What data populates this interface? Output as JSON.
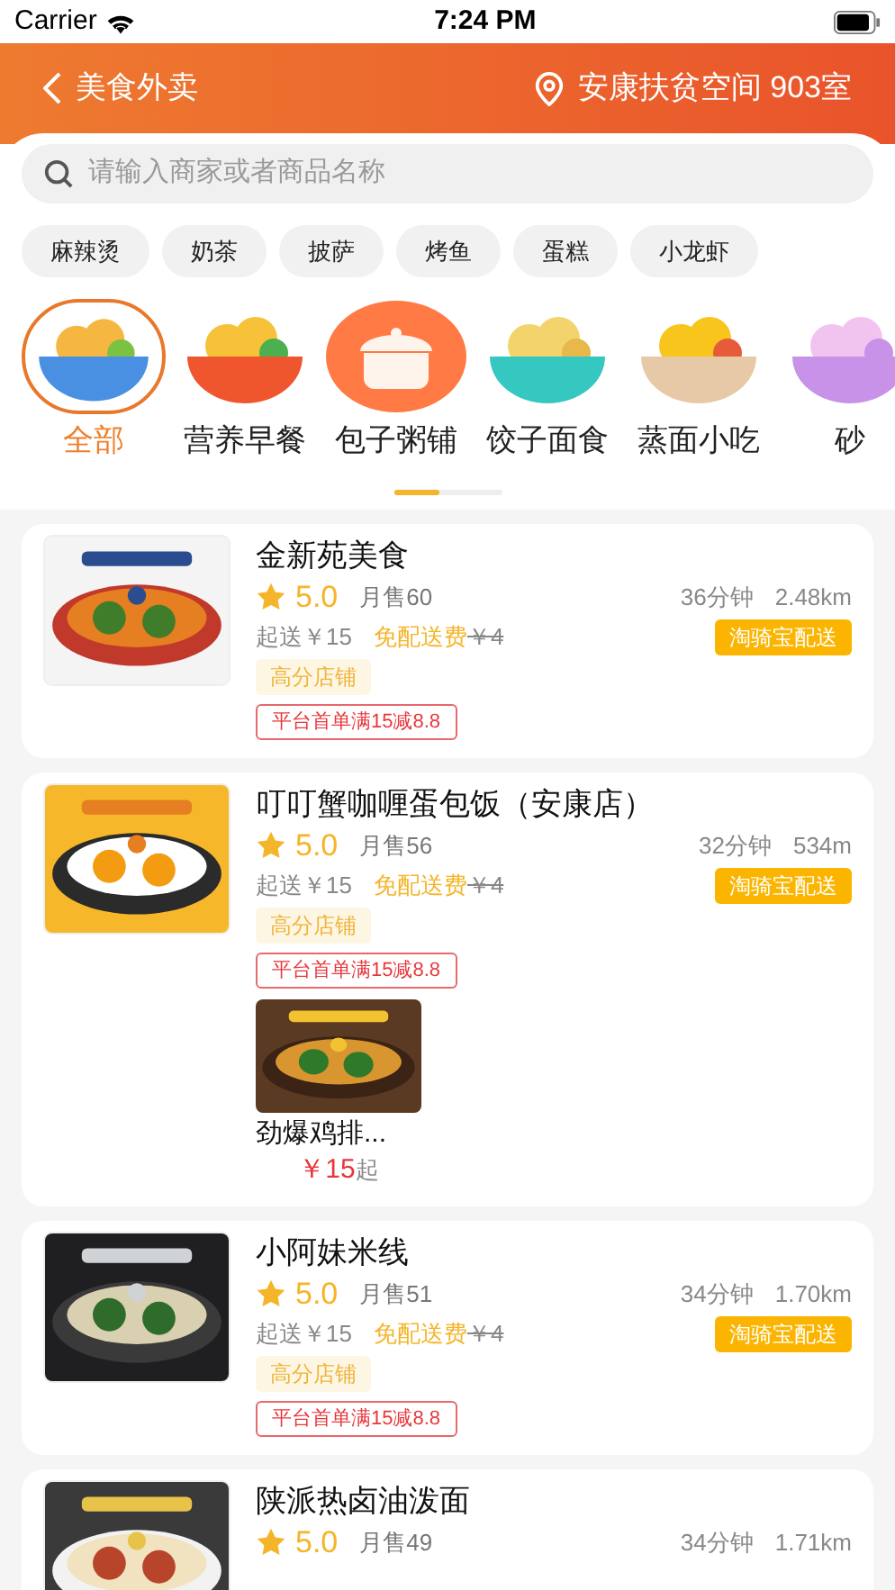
{
  "status_bar": {
    "carrier": "Carrier",
    "time": "7:24 PM"
  },
  "header": {
    "title": "美食外卖",
    "location": "安康扶贫空间 903室"
  },
  "search": {
    "placeholder": "请输入商家或者商品名称"
  },
  "tags": [
    "麻辣烫",
    "奶茶",
    "披萨",
    "烤鱼",
    "蛋糕",
    "小龙虾"
  ],
  "categories": [
    {
      "label": "全部",
      "selected": true
    },
    {
      "label": "营养早餐",
      "selected": false
    },
    {
      "label": "包子粥铺",
      "selected": false
    },
    {
      "label": "饺子面食",
      "selected": false
    },
    {
      "label": "蒸面小吃",
      "selected": false
    },
    {
      "label": "砂",
      "selected": false
    }
  ],
  "stores": [
    {
      "name": "金新苑美食",
      "rating": "5.0",
      "sales": "月售60",
      "time": "36分钟",
      "distance": "2.48km",
      "delivery": "淘骑宝配送",
      "min_order": "起送￥15",
      "free_delivery": "免配送费",
      "old_fee": "￥4",
      "badge": "高分店铺",
      "promo": "平台首单满15减8.8"
    },
    {
      "name": "叮叮蟹咖喱蛋包饭（安康店）",
      "rating": "5.0",
      "sales": "月售56",
      "time": "32分钟",
      "distance": "534m",
      "delivery": "淘骑宝配送",
      "min_order": "起送￥15",
      "free_delivery": "免配送费",
      "old_fee": "￥4",
      "badge": "高分店铺",
      "promo": "平台首单满15减8.8",
      "products": [
        {
          "name": "劲爆鸡排...",
          "price": "￥15",
          "suffix": "起"
        }
      ]
    },
    {
      "name": "小阿妹米线",
      "rating": "5.0",
      "sales": "月售51",
      "time": "34分钟",
      "distance": "1.70km",
      "delivery": "淘骑宝配送",
      "min_order": "起送￥15",
      "free_delivery": "免配送费",
      "old_fee": "￥4",
      "badge": "高分店铺",
      "promo": "平台首单满15减8.8"
    },
    {
      "name": "陕派热卤油泼面",
      "rating": "5.0",
      "sales": "月售49",
      "time": "34分钟",
      "distance": "1.71km"
    }
  ]
}
